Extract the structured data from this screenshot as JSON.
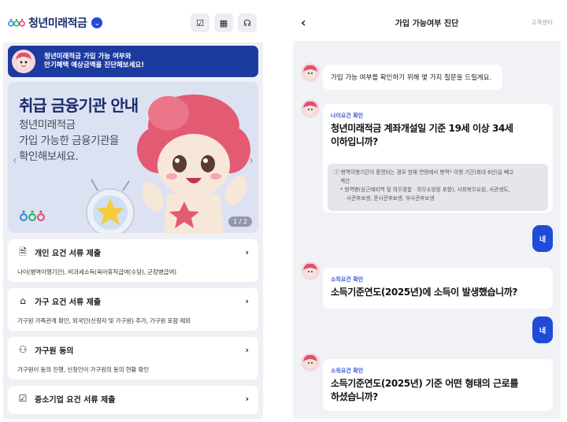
{
  "left": {
    "brand": {
      "title": "청년미래적금",
      "chevron": "⌄"
    },
    "header_icons": [
      {
        "name": "checklist-icon",
        "glyph": "☑"
      },
      {
        "name": "calendar-icon",
        "glyph": "▦"
      },
      {
        "name": "headset-icon",
        "glyph": "☊"
      }
    ],
    "notice": {
      "line1": "청년미래적금 가입 가능 여부와",
      "line2": "만기혜택 예상금액을 진단해보세요!"
    },
    "banner": {
      "title": "취급 금융기관 안내",
      "sub1": "청년미래적금",
      "sub2": "가입 가능한 금융기관을",
      "sub3": "확인해보세요.",
      "pager": "1 / 2",
      "prev": "‹",
      "next": "›"
    },
    "cards": [
      {
        "title": "개인 요건 서류 제출",
        "desc": "나이(병역이행기간), 비과세소득(육아휴직급여(수당), 군장병급여)",
        "icon": "document-icon",
        "glyph": "🗎"
      },
      {
        "title": "가구 요건 서류 제출",
        "desc": "가구원 가족관계 확인, 외국인(신청자 및 가구원) 추가, 가구원 포함·제외",
        "icon": "house-icon",
        "glyph": "⌂"
      },
      {
        "title": "가구원 동의",
        "desc": "가구원이 동의 진행, 신청인이 가구원의 동의 현황 확인",
        "icon": "person-icon",
        "glyph": "⚇"
      },
      {
        "title": "중소기업 요건 서류 제출",
        "desc": "",
        "icon": "checkbox-icon",
        "glyph": "☑"
      }
    ],
    "chevron": "›"
  },
  "right": {
    "header": {
      "title": "가입 가능여부 진단",
      "cs": "고객센터",
      "back": "‹"
    },
    "intro": "가입 가능 여부를 확인하기 위해 몇 가지 질문을 드릴게요.",
    "q1": {
      "tag": "나이요건 확인",
      "line1": "청년미래적금 계좌개설일 기준 19세 이상 34세",
      "line2": "이하입니까?"
    },
    "info": {
      "line1": "ⓘ 병역이행기간이 증명되는 경우 현재 연령에서 병역* 이행 기간(최대 6년)을 빼고",
      "line2": "계산",
      "line3": "* 현역병(상근예비역 및 의무경찰 · 의무소방원 포함), 사회복무요원, 사관생도,",
      "line4": "사관후보생, 준사관후보생, 부사관후보생"
    },
    "reply1": "네",
    "q2": {
      "tag": "소득요건 확인",
      "line1": "소득기준연도(2025년)에 소득이 발생했습니까?"
    },
    "reply2": "네",
    "q3": {
      "tag": "소득요건 확인",
      "line1": "소득기준연도(2025년) 기준 어떤 형태의 근로를",
      "line2": "하셨습니까?"
    }
  }
}
